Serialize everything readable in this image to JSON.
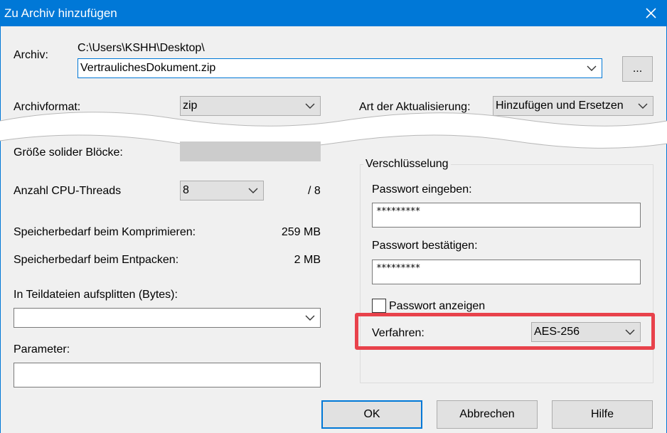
{
  "title": "Zu Archiv hinzufügen",
  "archive": {
    "label": "Archiv:",
    "path": "C:\\Users\\KSHH\\Desktop\\",
    "filename": "VertraulichesDokument.zip",
    "browse_label": "..."
  },
  "format": {
    "label": "Archivformat:",
    "value": "zip"
  },
  "update": {
    "label": "Art der Aktualisierung:",
    "value": "Hinzufügen und Ersetzen"
  },
  "solid": {
    "label": "Größe solider Blöcke:"
  },
  "cpu": {
    "label": "Anzahl CPU-Threads",
    "value": "8",
    "max": "/ 8"
  },
  "memory": {
    "compress_label": "Speicherbedarf beim Komprimieren:",
    "compress_value": "259 MB",
    "extract_label": "Speicherbedarf beim Entpacken:",
    "extract_value": "2 MB"
  },
  "split": {
    "label": "In Teildateien aufsplitten (Bytes):",
    "value": ""
  },
  "params": {
    "label": "Parameter:",
    "value": ""
  },
  "encryption": {
    "group_label": "Verschlüsselung",
    "password_label": "Passwort eingeben:",
    "password_value": "*********",
    "confirm_label": "Passwort bestätigen:",
    "confirm_value": "*********",
    "show_label": "Passwort anzeigen",
    "show_checked": false,
    "method_label": "Verfahren:",
    "method_value": "AES-256"
  },
  "buttons": {
    "ok": "OK",
    "cancel": "Abbrechen",
    "help": "Hilfe"
  },
  "colors": {
    "titlebar": "#0078d7",
    "highlight": "#e8424b",
    "background": "#f0f0f0"
  }
}
